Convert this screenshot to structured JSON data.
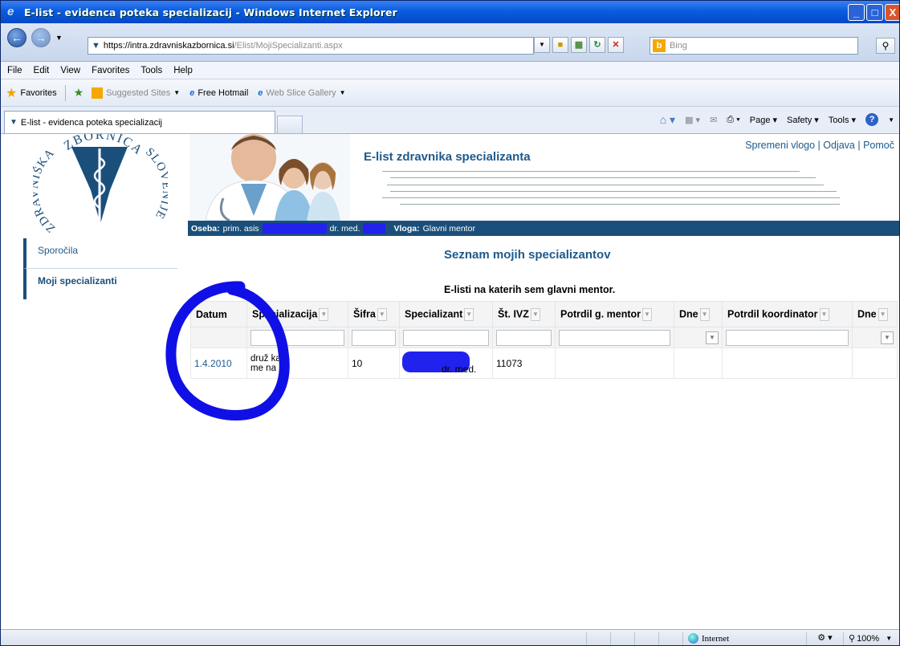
{
  "window": {
    "title": "E-list - evidenca poteka specializacij - Windows Internet Explorer",
    "min": "_",
    "max": "□",
    "close": "X"
  },
  "address": {
    "scheme": "https://",
    "host": "intra.zdravniskazbornica.si",
    "path": "/Elist/MojiSpecializanti.aspx",
    "search_placeholder": "Bing"
  },
  "menu": [
    "File",
    "Edit",
    "View",
    "Favorites",
    "Tools",
    "Help"
  ],
  "favorites_bar": {
    "favorites": "Favorites",
    "suggested": "Suggested Sites",
    "hotmail": "Free Hotmail",
    "webslice": "Web Slice Gallery"
  },
  "tab": {
    "title": "E-list - evidenca poteka specializacij"
  },
  "commandbar": {
    "page": "Page",
    "safety": "Safety",
    "tools": "Tools"
  },
  "app": {
    "title": "E-list zdravnika specializanta",
    "links": {
      "change_role": "Spremeni vlogo",
      "sep1": " | ",
      "logout": "Odjava",
      "sep2": " | ",
      "help": "Pomoč"
    },
    "logo_text": {
      "top": "ZBORNICA",
      "left": "ZDRAVNIŠKA",
      "right": "SLOVENIJE"
    }
  },
  "infobar": {
    "person_label": "Oseba:",
    "person_prefix": "prim. asis",
    "person_suffix": "dr. med.",
    "role_label": "Vloga:",
    "role_value": "Glavni mentor"
  },
  "sidebar": {
    "items": [
      {
        "label": "Sporočila",
        "active": false
      },
      {
        "label": "Moji specializanti",
        "active": true
      }
    ]
  },
  "page": {
    "title": "Seznam mojih specializantov",
    "subtitle": "E-listi na katerih sem glavni mentor."
  },
  "grid": {
    "columns": [
      "Datum",
      "Specializacija",
      "Šifra",
      "Specializant",
      "Št. IVZ",
      "Potrdil g. mentor",
      "Dne",
      "Potrdil koordinator",
      "Dne"
    ],
    "rows": [
      {
        "datum": "1.4.2010",
        "specializacija_line1": "druž ka",
        "specializacija_line2": "me na",
        "sifra": "10",
        "specializant": "dr. med.",
        "st_ivz": "11073",
        "potrdil_g_mentor": "",
        "dne1": "",
        "potrdil_koordinator": "",
        "dne2": ""
      }
    ]
  },
  "statusbar": {
    "zone": "Internet",
    "zoom": "100%"
  },
  "colors": {
    "title_bar": "#0a5ce0",
    "info_bar": "#1b4f7b",
    "link": "#1f5a8c",
    "annotation_circle": "#1010e6"
  }
}
